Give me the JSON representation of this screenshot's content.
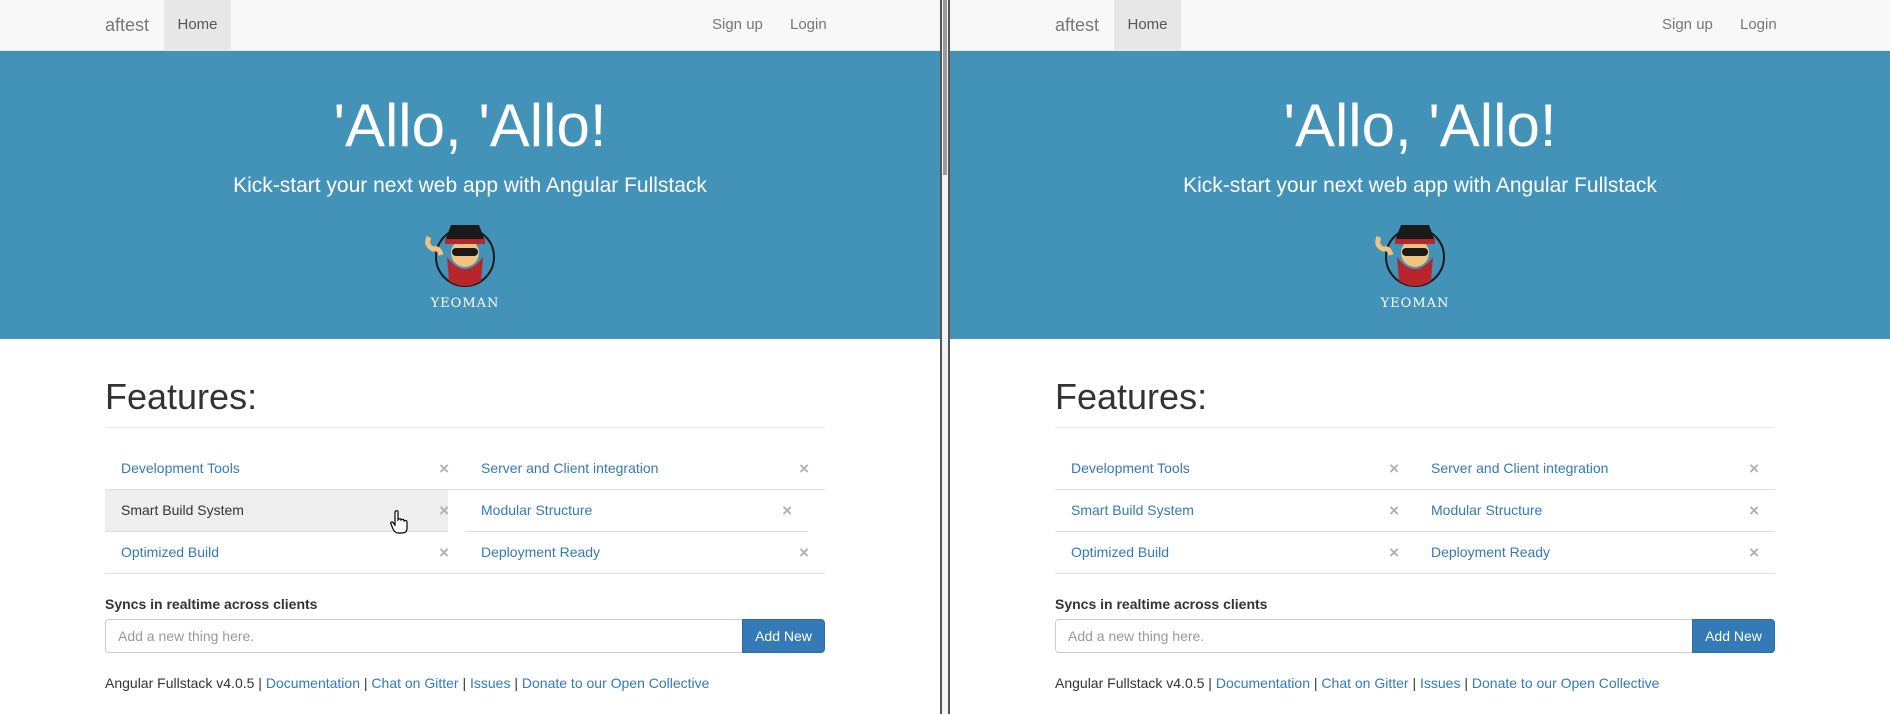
{
  "nav": {
    "brand": "aftest",
    "home": "Home",
    "signup": "Sign up",
    "login": "Login"
  },
  "hero": {
    "title": "'Allo, 'Allo!",
    "lead": "Kick-start your next web app with Angular Fullstack",
    "logo_text": "YEOMAN"
  },
  "features": {
    "title": "Features:",
    "items": [
      {
        "label": "Development Tools",
        "close": "×"
      },
      {
        "label": "Server and Client integration",
        "close": "×"
      },
      {
        "label": "Smart Build System",
        "close": "×"
      },
      {
        "label": "Modular Structure",
        "close": "×"
      },
      {
        "label": "Optimized Build",
        "close": "×"
      },
      {
        "label": "Deployment Ready",
        "close": "×"
      }
    ]
  },
  "sync": {
    "label": "Syncs in realtime across clients",
    "placeholder": "Add a new thing here.",
    "button": "Add New"
  },
  "footer": {
    "version": "Angular Fullstack v4.0.5",
    "sep": " | ",
    "links": [
      "Documentation",
      "Chat on Gitter",
      "Issues",
      "Donate to our Open Collective"
    ]
  },
  "colors": {
    "hero_bg": "#4393b9",
    "link": "#337ab7",
    "button": "#337ab7"
  },
  "icons": {
    "close": "close-icon",
    "logo": "yeoman-logo-icon",
    "cursor": "hand-pointer-cursor-icon"
  }
}
